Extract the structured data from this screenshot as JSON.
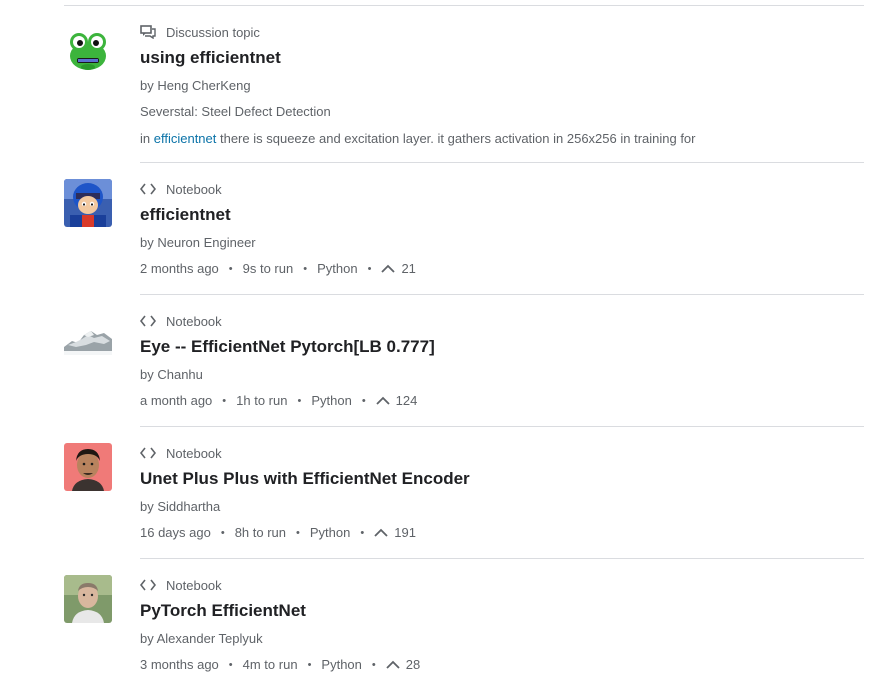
{
  "results": [
    {
      "type": "Discussion topic",
      "title": "using efficientnet",
      "author": "by Heng CherKeng",
      "competition": "Severstal: Steel Defect Detection",
      "snippet_prefix": "in ",
      "snippet_link": "efficientnet",
      "snippet_rest": " there is squeeze and excitation layer. it gathers activation in 256x256 in training for"
    },
    {
      "type": "Notebook",
      "title": "efficientnet",
      "author": "by Neuron Engineer",
      "age": "2 months ago",
      "runtime": "9s to run",
      "language": "Python",
      "votes": "21"
    },
    {
      "type": "Notebook",
      "title": "Eye -- EfficientNet Pytorch[LB 0.777]",
      "author": "by Chanhu",
      "age": "a month ago",
      "runtime": "1h to run",
      "language": "Python",
      "votes": "124"
    },
    {
      "type": "Notebook",
      "title": "Unet Plus Plus with EfficientNet Encoder",
      "author": "by Siddhartha",
      "age": "16 days ago",
      "runtime": "8h to run",
      "language": "Python",
      "votes": "191"
    },
    {
      "type": "Notebook",
      "title": "PyTorch EfficientNet",
      "author": "by Alexander Teplyuk",
      "age": "3 months ago",
      "runtime": "4m to run",
      "language": "Python",
      "votes": "28"
    }
  ],
  "separator": "•",
  "colors": {
    "link": "#0b73a8",
    "meta_text": "#5f6368",
    "title_text": "#202124",
    "divider": "#dadce0"
  }
}
